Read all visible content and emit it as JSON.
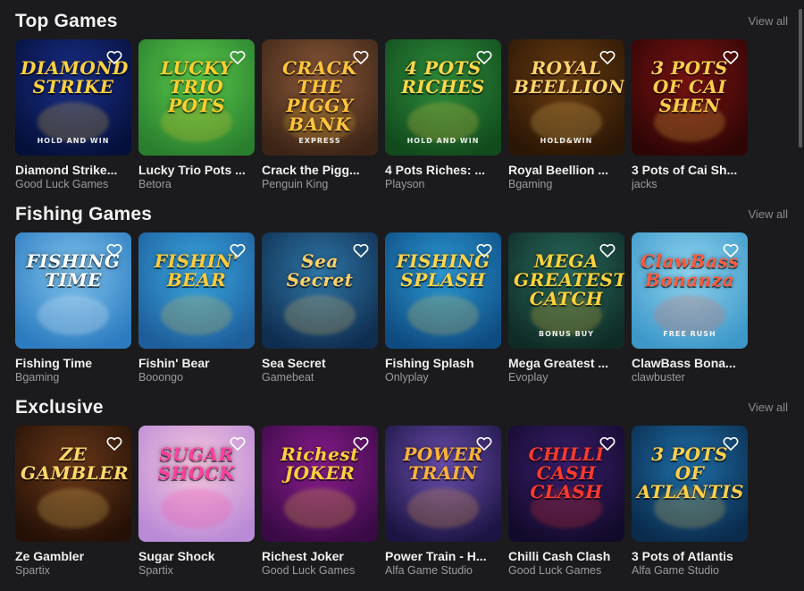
{
  "sections": [
    {
      "title": "Top Games",
      "view_all": "View all",
      "games": [
        {
          "name": "Diamond Strike...",
          "provider": "Good Luck Games",
          "art_title": "DIAMOND STRIKE",
          "art_sub": "HOLD AND WIN",
          "bg1": "#1a2f8a",
          "bg2": "#05103a",
          "accent": "#ffd23f"
        },
        {
          "name": "Lucky Trio Pots ...",
          "provider": "Betora",
          "art_title": "LUCKY TRIO POTS",
          "art_sub": "",
          "bg1": "#58c94a",
          "bg2": "#2a7f2f",
          "accent": "#ffcf2e"
        },
        {
          "name": "Crack the Pigg...",
          "provider": "Penguin King",
          "art_title": "CRACK THE PIGGY BANK",
          "art_sub": "EXPRESS",
          "bg1": "#8c5a3a",
          "bg2": "#3b2416",
          "accent": "#ffc43b"
        },
        {
          "name": "4 Pots Riches: ...",
          "provider": "Playson",
          "art_title": "4 POTS RICHES",
          "art_sub": "HOLD AND WIN",
          "bg1": "#2f8f3c",
          "bg2": "#114a1d",
          "accent": "#ffd84a"
        },
        {
          "name": "Royal Beellion ...",
          "provider": "Bgaming",
          "art_title": "ROYAL BEELLION",
          "art_sub": "HOLD&WIN",
          "bg1": "#6b3d12",
          "bg2": "#2a1605",
          "accent": "#ffd36b"
        },
        {
          "name": "3 Pots of Cai Sh...",
          "provider": "jacks",
          "art_title": "3 POTS OF CAI SHEN",
          "art_sub": "",
          "bg1": "#7a1412",
          "bg2": "#2e0505",
          "accent": "#ffcd4a"
        }
      ]
    },
    {
      "title": "Fishing Games",
      "view_all": "View all",
      "games": [
        {
          "name": "Fishing Time",
          "provider": "Bgaming",
          "art_title": "FISHING TIME",
          "art_sub": "",
          "bg1": "#7fc3ee",
          "bg2": "#2c7bbf",
          "accent": "#ffffff"
        },
        {
          "name": "Fishin' Bear",
          "provider": "Booongo",
          "art_title": "FISHIN' BEAR",
          "art_sub": "",
          "bg1": "#3aa7e0",
          "bg2": "#1d5d9a",
          "accent": "#ffcc3a"
        },
        {
          "name": "Sea Secret",
          "provider": "Gamebeat",
          "art_title": "Sea Secret",
          "art_sub": "",
          "bg1": "#2f77a8",
          "bg2": "#0f2d4e",
          "accent": "#ffd066"
        },
        {
          "name": "Fishing Splash",
          "provider": "Onlyplay",
          "art_title": "FISHING SPLASH",
          "art_sub": "",
          "bg1": "#2c9ad6",
          "bg2": "#0e4b80",
          "accent": "#ffd44a"
        },
        {
          "name": "Mega Greatest ...",
          "provider": "Evoplay",
          "art_title": "MEGA GREATEST CATCH",
          "art_sub": "BONUS BUY",
          "bg1": "#2a6d5f",
          "bg2": "#0f2b25",
          "accent": "#ffd23a"
        },
        {
          "name": "ClawBass Bona...",
          "provider": "clawbuster",
          "art_title": "ClawBass Bonanza",
          "art_sub": "FREE RUSH",
          "bg1": "#8fd4f0",
          "bg2": "#3d98c9",
          "accent": "#ff5a3c"
        }
      ]
    },
    {
      "title": "Exclusive",
      "view_all": "View all",
      "games": [
        {
          "name": "Ze Gambler",
          "provider": "Spartix",
          "art_title": "ZE GAMBLER",
          "art_sub": "",
          "bg1": "#6b3a1a",
          "bg2": "#241006",
          "accent": "#ffd86a"
        },
        {
          "name": "Sugar Shock",
          "provider": "Spartix",
          "art_title": "SUGAR SHOCK",
          "art_sub": "",
          "bg1": "#f6c6de",
          "bg2": "#b98ad6",
          "accent": "#ff3fa0"
        },
        {
          "name": "Richest Joker",
          "provider": "Good Luck Games",
          "art_title": "Richest JOKER",
          "art_sub": "",
          "bg1": "#8a1d8f",
          "bg2": "#3a0a45",
          "accent": "#ffcf3a"
        },
        {
          "name": "Power Train - H...",
          "provider": "Alfa Game Studio",
          "art_title": "POWER TRAIN",
          "art_sub": "",
          "bg1": "#6a4fae",
          "bg2": "#1c1442",
          "accent": "#ffb13a"
        },
        {
          "name": "Chilli Cash Clash",
          "provider": "Good Luck Games",
          "art_title": "CHILLI CASH CLASH",
          "art_sub": "",
          "bg1": "#3a1f6e",
          "bg2": "#120a2a",
          "accent": "#ff3a2e"
        },
        {
          "name": "3 Pots of Atlantis",
          "provider": "Alfa Game Studio",
          "art_title": "3 POTS OF ATLANTIS",
          "art_sub": "",
          "bg1": "#1f6fa8",
          "bg2": "#0a2b4c",
          "accent": "#ffcf4a"
        }
      ]
    }
  ],
  "icons": {
    "favorite": "heart-outline-icon"
  }
}
